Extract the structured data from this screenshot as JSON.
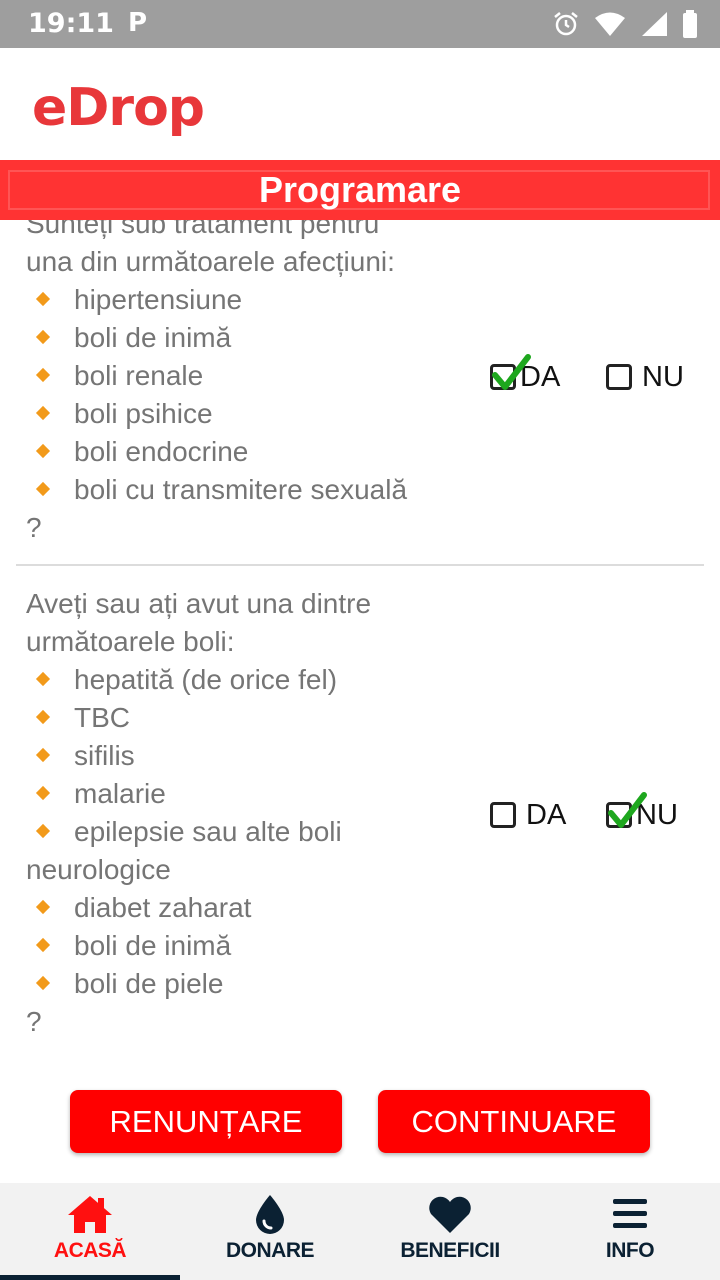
{
  "status_bar": {
    "time": "19:11",
    "notification_icon": "P"
  },
  "header": {
    "logo": "eDrop"
  },
  "title": "Programare",
  "questions": [
    {
      "text_lines": [
        "Sunteți sub tratament pentru",
        "una din următoarele afecțiuni:"
      ],
      "items": [
        "hipertensiune",
        "boli de inimă",
        "boli renale",
        "boli psihice",
        "boli endocrine",
        "boli cu transmitere sexuală"
      ],
      "suffix": "?",
      "options": {
        "yes": "DA",
        "no": "NU"
      },
      "selected": "DA"
    },
    {
      "text_lines": [
        "Aveți sau ați avut una dintre",
        "următoarele boli:"
      ],
      "items": [
        "hepatită (de orice fel)",
        "TBC",
        "sifilis",
        "malarie",
        "epilepsie sau alte boli neurologice",
        "diabet zaharat",
        "boli de inimă",
        "boli de piele"
      ],
      "suffix": "?",
      "options": {
        "yes": "DA",
        "no": "NU"
      },
      "selected": "NU"
    }
  ],
  "buttons": {
    "cancel": "RENUNȚARE",
    "continue": "CONTINUARE"
  },
  "nav": {
    "items": [
      {
        "label": "ACASĂ",
        "icon": "home-icon",
        "active": true
      },
      {
        "label": "DONARE",
        "icon": "drop-icon",
        "active": false
      },
      {
        "label": "BENEFICII",
        "icon": "heart-icon",
        "active": false
      },
      {
        "label": "INFO",
        "icon": "menu-icon",
        "active": false
      }
    ]
  },
  "colors": {
    "brand_red": "#ff0000",
    "title_red": "#ff3333",
    "check_green": "#1ea71e",
    "bullet_orange": "#f29a1a",
    "nav_dark": "#0b2133"
  }
}
